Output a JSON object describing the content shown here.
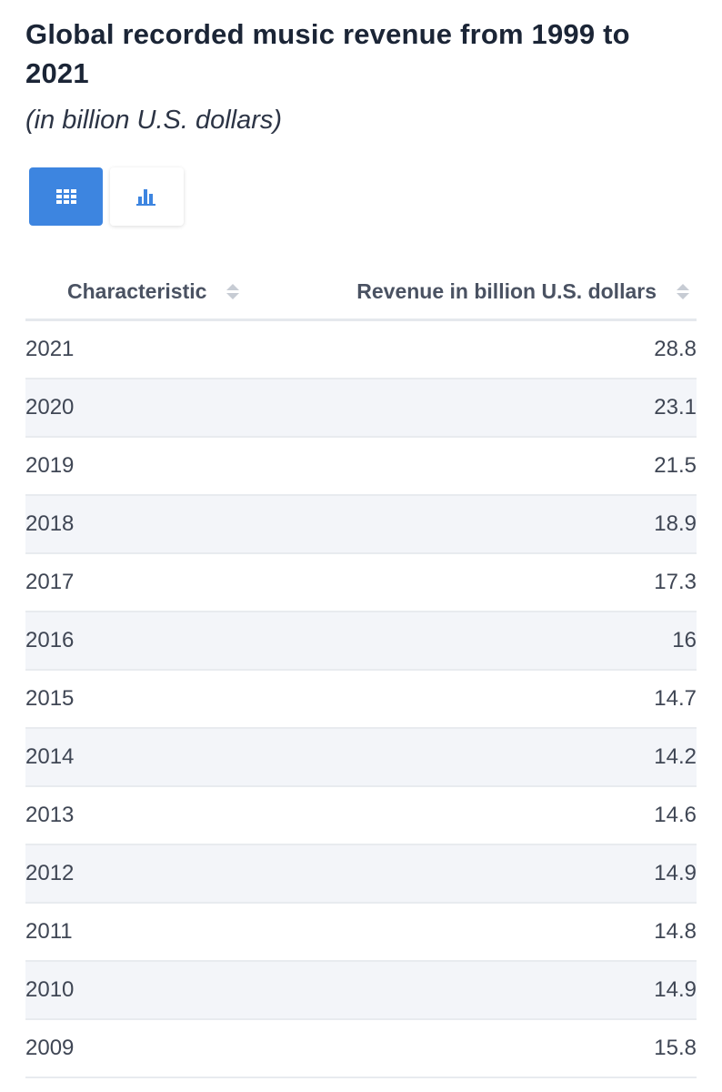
{
  "title": "Global recorded music revenue from 1999 to 2021",
  "subtitle": "(in billion U.S. dollars)",
  "view_toggle": {
    "table_icon": "table-grid-icon",
    "chart_icon": "bar-chart-icon",
    "active": "table",
    "active_color": "#3d85e0"
  },
  "chart_data": {
    "type": "table",
    "columns": [
      "Characteristic",
      "Revenue in billion U.S. dollars"
    ],
    "rows": [
      {
        "year": "2021",
        "value": "28.8"
      },
      {
        "year": "2020",
        "value": "23.1"
      },
      {
        "year": "2019",
        "value": "21.5"
      },
      {
        "year": "2018",
        "value": "18.9"
      },
      {
        "year": "2017",
        "value": "17.3"
      },
      {
        "year": "2016",
        "value": "16"
      },
      {
        "year": "2015",
        "value": "14.7"
      },
      {
        "year": "2014",
        "value": "14.2"
      },
      {
        "year": "2013",
        "value": "14.6"
      },
      {
        "year": "2012",
        "value": "14.9"
      },
      {
        "year": "2011",
        "value": "14.8"
      },
      {
        "year": "2010",
        "value": "14.9"
      },
      {
        "year": "2009",
        "value": "15.8"
      }
    ]
  }
}
